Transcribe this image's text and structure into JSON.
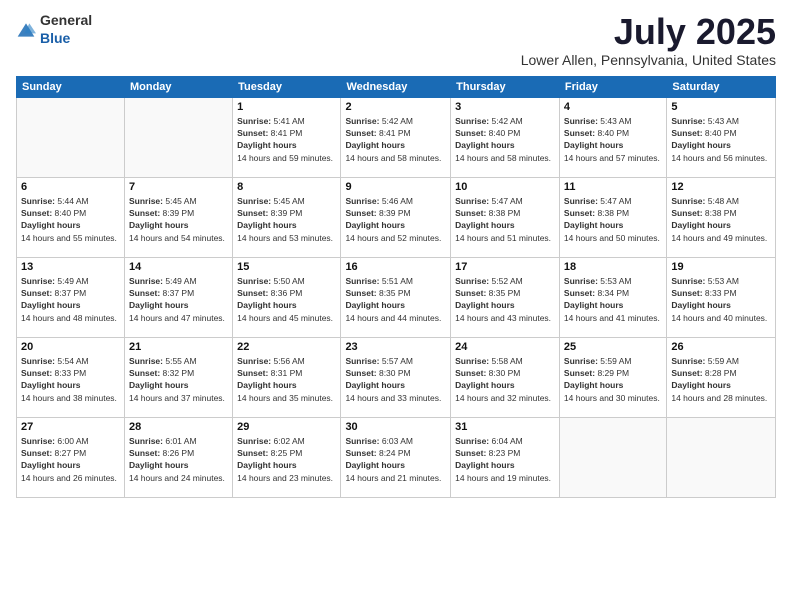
{
  "header": {
    "logo": {
      "general": "General",
      "blue": "Blue"
    },
    "month": "July 2025",
    "location": "Lower Allen, Pennsylvania, United States"
  },
  "weekdays": [
    "Sunday",
    "Monday",
    "Tuesday",
    "Wednesday",
    "Thursday",
    "Friday",
    "Saturday"
  ],
  "weeks": [
    [
      {
        "day": null
      },
      {
        "day": null
      },
      {
        "day": "1",
        "sunrise": "5:41 AM",
        "sunset": "8:41 PM",
        "daylight": "14 hours and 59 minutes."
      },
      {
        "day": "2",
        "sunrise": "5:42 AM",
        "sunset": "8:41 PM",
        "daylight": "14 hours and 58 minutes."
      },
      {
        "day": "3",
        "sunrise": "5:42 AM",
        "sunset": "8:40 PM",
        "daylight": "14 hours and 58 minutes."
      },
      {
        "day": "4",
        "sunrise": "5:43 AM",
        "sunset": "8:40 PM",
        "daylight": "14 hours and 57 minutes."
      },
      {
        "day": "5",
        "sunrise": "5:43 AM",
        "sunset": "8:40 PM",
        "daylight": "14 hours and 56 minutes."
      }
    ],
    [
      {
        "day": "6",
        "sunrise": "5:44 AM",
        "sunset": "8:40 PM",
        "daylight": "14 hours and 55 minutes."
      },
      {
        "day": "7",
        "sunrise": "5:45 AM",
        "sunset": "8:39 PM",
        "daylight": "14 hours and 54 minutes."
      },
      {
        "day": "8",
        "sunrise": "5:45 AM",
        "sunset": "8:39 PM",
        "daylight": "14 hours and 53 minutes."
      },
      {
        "day": "9",
        "sunrise": "5:46 AM",
        "sunset": "8:39 PM",
        "daylight": "14 hours and 52 minutes."
      },
      {
        "day": "10",
        "sunrise": "5:47 AM",
        "sunset": "8:38 PM",
        "daylight": "14 hours and 51 minutes."
      },
      {
        "day": "11",
        "sunrise": "5:47 AM",
        "sunset": "8:38 PM",
        "daylight": "14 hours and 50 minutes."
      },
      {
        "day": "12",
        "sunrise": "5:48 AM",
        "sunset": "8:38 PM",
        "daylight": "14 hours and 49 minutes."
      }
    ],
    [
      {
        "day": "13",
        "sunrise": "5:49 AM",
        "sunset": "8:37 PM",
        "daylight": "14 hours and 48 minutes."
      },
      {
        "day": "14",
        "sunrise": "5:49 AM",
        "sunset": "8:37 PM",
        "daylight": "14 hours and 47 minutes."
      },
      {
        "day": "15",
        "sunrise": "5:50 AM",
        "sunset": "8:36 PM",
        "daylight": "14 hours and 45 minutes."
      },
      {
        "day": "16",
        "sunrise": "5:51 AM",
        "sunset": "8:35 PM",
        "daylight": "14 hours and 44 minutes."
      },
      {
        "day": "17",
        "sunrise": "5:52 AM",
        "sunset": "8:35 PM",
        "daylight": "14 hours and 43 minutes."
      },
      {
        "day": "18",
        "sunrise": "5:53 AM",
        "sunset": "8:34 PM",
        "daylight": "14 hours and 41 minutes."
      },
      {
        "day": "19",
        "sunrise": "5:53 AM",
        "sunset": "8:33 PM",
        "daylight": "14 hours and 40 minutes."
      }
    ],
    [
      {
        "day": "20",
        "sunrise": "5:54 AM",
        "sunset": "8:33 PM",
        "daylight": "14 hours and 38 minutes."
      },
      {
        "day": "21",
        "sunrise": "5:55 AM",
        "sunset": "8:32 PM",
        "daylight": "14 hours and 37 minutes."
      },
      {
        "day": "22",
        "sunrise": "5:56 AM",
        "sunset": "8:31 PM",
        "daylight": "14 hours and 35 minutes."
      },
      {
        "day": "23",
        "sunrise": "5:57 AM",
        "sunset": "8:30 PM",
        "daylight": "14 hours and 33 minutes."
      },
      {
        "day": "24",
        "sunrise": "5:58 AM",
        "sunset": "8:30 PM",
        "daylight": "14 hours and 32 minutes."
      },
      {
        "day": "25",
        "sunrise": "5:59 AM",
        "sunset": "8:29 PM",
        "daylight": "14 hours and 30 minutes."
      },
      {
        "day": "26",
        "sunrise": "5:59 AM",
        "sunset": "8:28 PM",
        "daylight": "14 hours and 28 minutes."
      }
    ],
    [
      {
        "day": "27",
        "sunrise": "6:00 AM",
        "sunset": "8:27 PM",
        "daylight": "14 hours and 26 minutes."
      },
      {
        "day": "28",
        "sunrise": "6:01 AM",
        "sunset": "8:26 PM",
        "daylight": "14 hours and 24 minutes."
      },
      {
        "day": "29",
        "sunrise": "6:02 AM",
        "sunset": "8:25 PM",
        "daylight": "14 hours and 23 minutes."
      },
      {
        "day": "30",
        "sunrise": "6:03 AM",
        "sunset": "8:24 PM",
        "daylight": "14 hours and 21 minutes."
      },
      {
        "day": "31",
        "sunrise": "6:04 AM",
        "sunset": "8:23 PM",
        "daylight": "14 hours and 19 minutes."
      },
      {
        "day": null
      },
      {
        "day": null
      }
    ]
  ],
  "labels": {
    "sunrise": "Sunrise:",
    "sunset": "Sunset:",
    "daylight": "Daylight:"
  }
}
